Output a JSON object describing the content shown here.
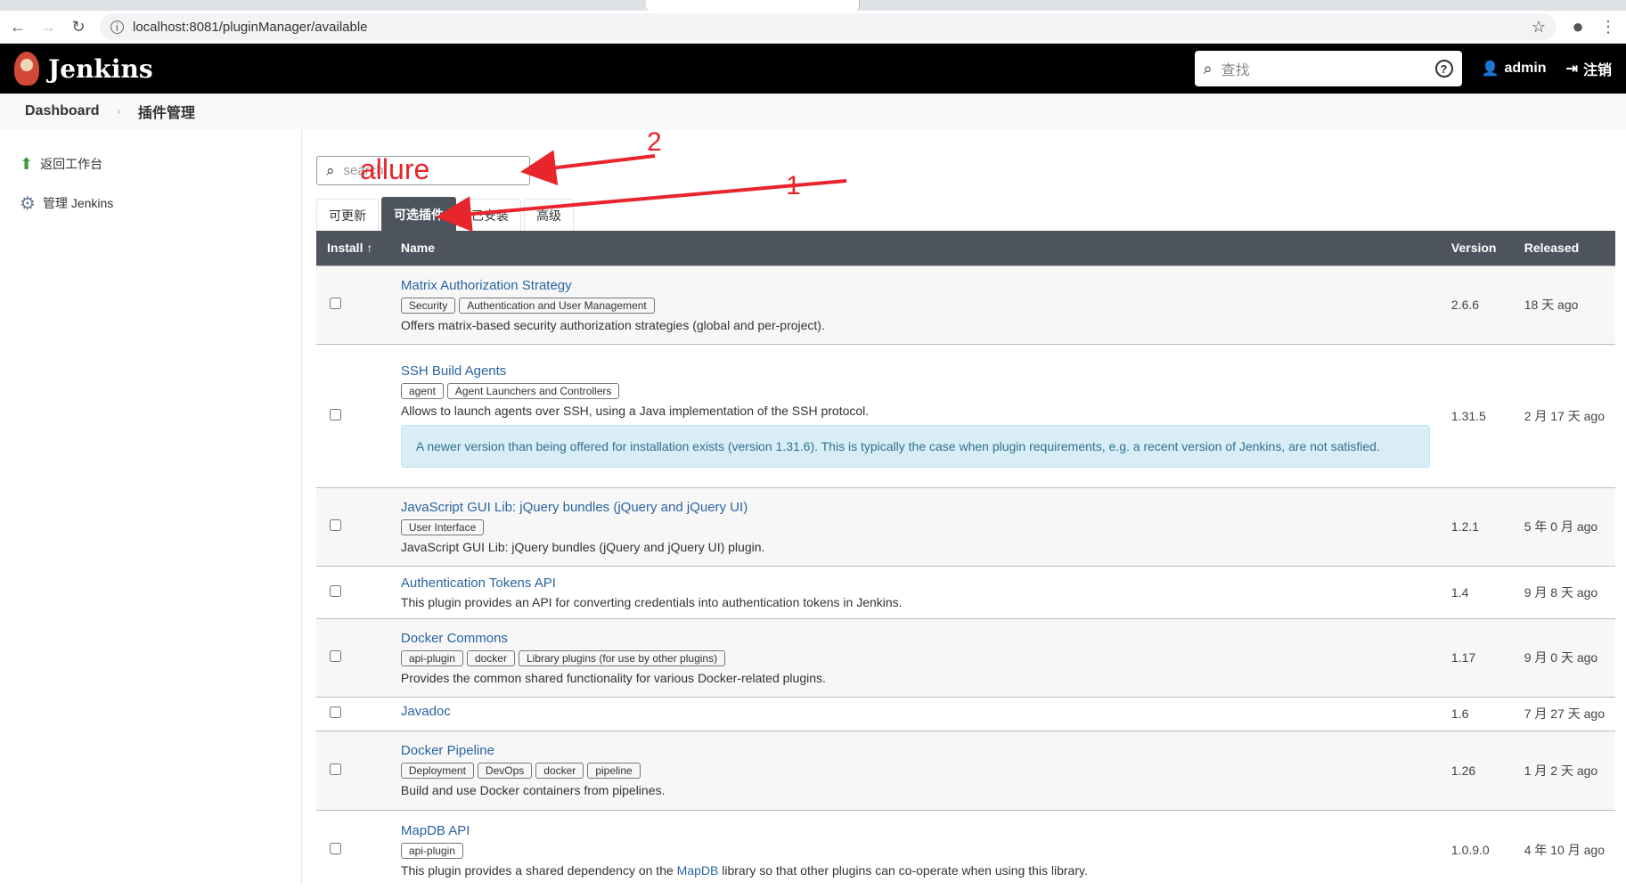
{
  "browser": {
    "url": "localhost:8081/pluginManager/available"
  },
  "header": {
    "brand": "Jenkins",
    "search_placeholder": "查找",
    "user": "admin",
    "logout": "注销"
  },
  "breadcrumb": [
    "Dashboard",
    "插件管理"
  ],
  "sidebar": [
    {
      "label": "返回工作台",
      "icon": "up-arrow-icon"
    },
    {
      "label": "管理 Jenkins",
      "icon": "gear-icon"
    }
  ],
  "filter": {
    "placeholder": "search"
  },
  "tabs": [
    "可更新",
    "可选插件",
    "已安装",
    "高级"
  ],
  "table": {
    "headers": {
      "install": "Install ↑",
      "name": "Name",
      "version": "Version",
      "released": "Released"
    },
    "rows": [
      {
        "name": "Matrix Authorization Strategy",
        "labels": [
          "Security",
          "Authentication and User Management"
        ],
        "desc": "Offers matrix-based security authorization strategies (global and per-project).",
        "version": "2.6.6",
        "released": "18 天 ago"
      },
      {
        "name": "SSH Build Agents",
        "labels": [
          "agent",
          "Agent Launchers and Controllers"
        ],
        "desc": "Allows to launch agents over SSH, using a Java implementation of the SSH protocol.",
        "notice": "A newer version than being offered for installation exists (version 1.31.6). This is typically the case when plugin requirements, e.g. a recent version of Jenkins, are not satisfied.",
        "version": "1.31.5",
        "released": "2 月 17 天 ago"
      },
      {
        "name": "JavaScript GUI Lib: jQuery bundles (jQuery and jQuery UI)",
        "labels": [
          "User Interface"
        ],
        "desc": "JavaScript GUI Lib: jQuery bundles (jQuery and jQuery UI) plugin.",
        "version": "1.2.1",
        "released": "5 年 0 月 ago"
      },
      {
        "name": "Authentication Tokens API",
        "labels": [],
        "desc": "This plugin provides an API for converting credentials into authentication tokens in Jenkins.",
        "version": "1.4",
        "released": "9 月 8 天 ago"
      },
      {
        "name": "Docker Commons",
        "labels": [
          "api-plugin",
          "docker",
          "Library plugins (for use by other plugins)"
        ],
        "desc": "Provides the common shared functionality for various Docker-related plugins.",
        "version": "1.17",
        "released": "9 月 0 天 ago"
      },
      {
        "name": "Javadoc",
        "labels": [],
        "desc": "",
        "version": "1.6",
        "released": "7 月 27 天 ago"
      },
      {
        "name": "Docker Pipeline",
        "labels": [
          "Deployment",
          "DevOps",
          "docker",
          "pipeline"
        ],
        "desc": "Build and use Docker containers from pipelines.",
        "version": "1.26",
        "released": "1 月 2 天 ago"
      },
      {
        "name": "MapDB API",
        "labels": [
          "api-plugin"
        ],
        "desc_pre": "This plugin provides a shared dependency on the ",
        "desc_link": "MapDB",
        "desc_post": " library so that other plugins can co-operate when using this library.",
        "version": "1.0.9.0",
        "released": "4 年 10 月 ago"
      }
    ]
  },
  "annotations": {
    "typed": "allure",
    "step1": "1",
    "step2": "2",
    "color": "#e8242c"
  }
}
